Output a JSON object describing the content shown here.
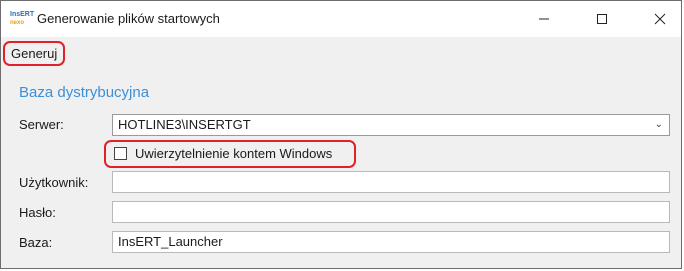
{
  "window": {
    "logo_top": "InsERT",
    "logo_bottom": "nexo",
    "title": "Generowanie plików startowych",
    "min_icon": "minimize-icon",
    "max_icon": "maximize-icon",
    "close_icon": "close-icon"
  },
  "menu": {
    "generate_label": "Generuj"
  },
  "section": {
    "title": "Baza dystrybucyjna"
  },
  "form": {
    "server_label": "Serwer:",
    "server_value": "HOTLINE3\\INSERTGT",
    "windows_auth_label": "Uwierzytelnienie kontem Windows",
    "windows_auth_checked": false,
    "user_label": "Użytkownik:",
    "user_value": "",
    "password_label": "Hasło:",
    "password_value": "",
    "database_label": "Baza:",
    "database_value": "InsERT_Launcher"
  },
  "colors": {
    "accent": "#3d8fd6",
    "highlight": "#e0202a"
  }
}
